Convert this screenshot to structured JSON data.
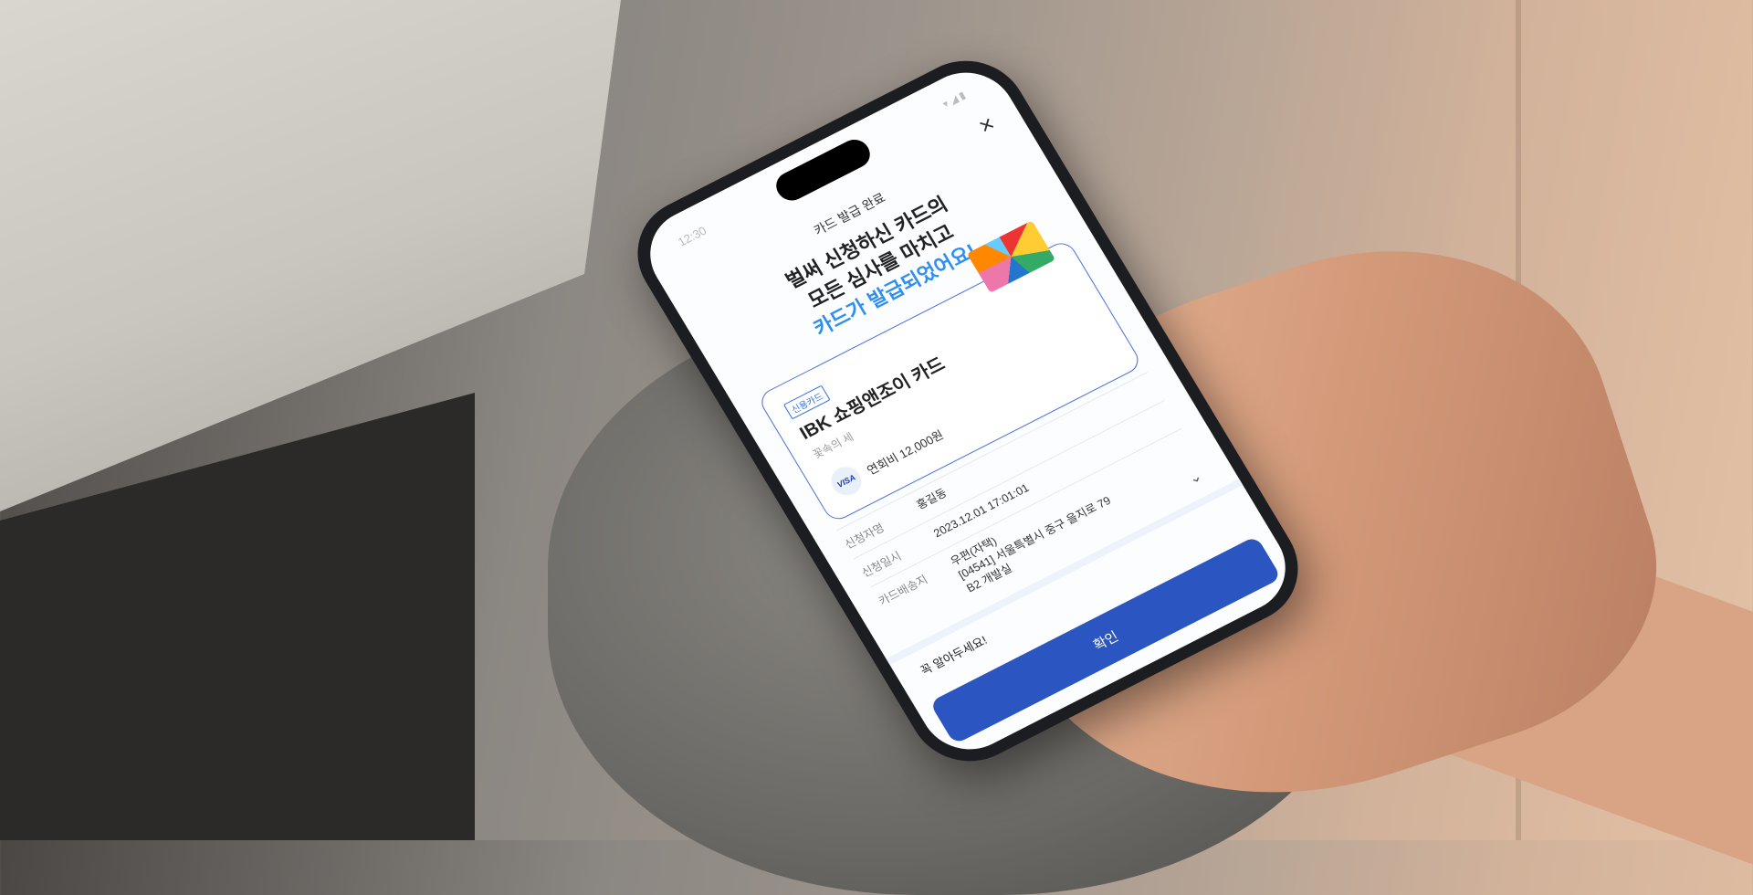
{
  "status_bar": {
    "time": "12:30",
    "icons": "▾◢▮"
  },
  "header": {
    "title": "카드 발급 완료",
    "close_icon": "×"
  },
  "headline": {
    "line1": "벌써 신청하신 카드의",
    "line2": "모든 심사를 마치고",
    "line3": "카드가 발급되었어요!"
  },
  "card": {
    "type_badge": "신용카드",
    "name": "IBK 쇼핑앤조이 카드",
    "design": "꽃속의 세",
    "brand": "VISA",
    "annual_fee": "연회비 12,000원"
  },
  "details": [
    {
      "label": "신청자명",
      "value": "홍길동"
    },
    {
      "label": "신청일시",
      "value": "2023.12.01 17:01:01"
    },
    {
      "label": "카드배송지",
      "value": "우편(자택)\n[04541] 서울특별시 중구 을지로 79\nB2 개발실"
    }
  ],
  "expand_icon": "⌄",
  "notice": "꼭 알아두세요!",
  "confirm_label": "확인",
  "colors": {
    "accent": "#2f8ff0",
    "button": "#2b55c0",
    "card_border": "#4b6fd8"
  }
}
